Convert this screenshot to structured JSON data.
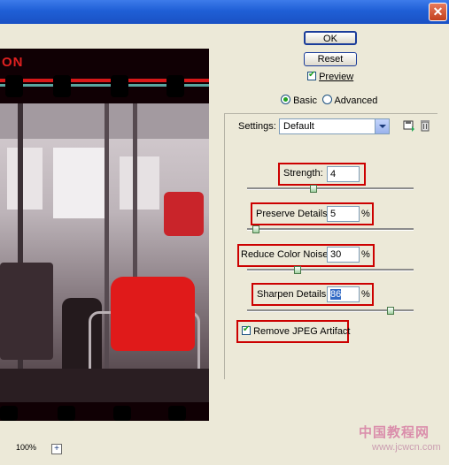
{
  "window": {
    "close_glyph": "✕"
  },
  "preview": {
    "brand_text": "ON",
    "zoom": "100%",
    "zoom_in_glyph": "+"
  },
  "buttons": {
    "ok": "OK",
    "reset": "Reset"
  },
  "preview_checkbox": {
    "label": "Preview",
    "checked": true
  },
  "mode": {
    "basic": "Basic",
    "advanced": "Advanced",
    "selected": "Basic"
  },
  "settings": {
    "label": "Settings:",
    "value": "Default"
  },
  "sliders": {
    "strength": {
      "label": "Strength:",
      "value": "4"
    },
    "preserve_details": {
      "label": "Preserve Details:",
      "value": "5",
      "unit": "%"
    },
    "reduce_color_noise": {
      "label": "Reduce Color Noise:",
      "value": "30",
      "unit": "%"
    },
    "sharpen_details": {
      "label": "Sharpen Details:",
      "value": "86",
      "unit": "%"
    }
  },
  "remove_jpeg": {
    "label": "Remove JPEG Artifact",
    "checked": true
  },
  "watermark": {
    "main": "中国教程网",
    "sub": "www.jcwcn.com"
  },
  "colors": {
    "highlight_red": "#cc0000",
    "accent_blue": "#1a3c9a",
    "check_green": "#21a121"
  }
}
